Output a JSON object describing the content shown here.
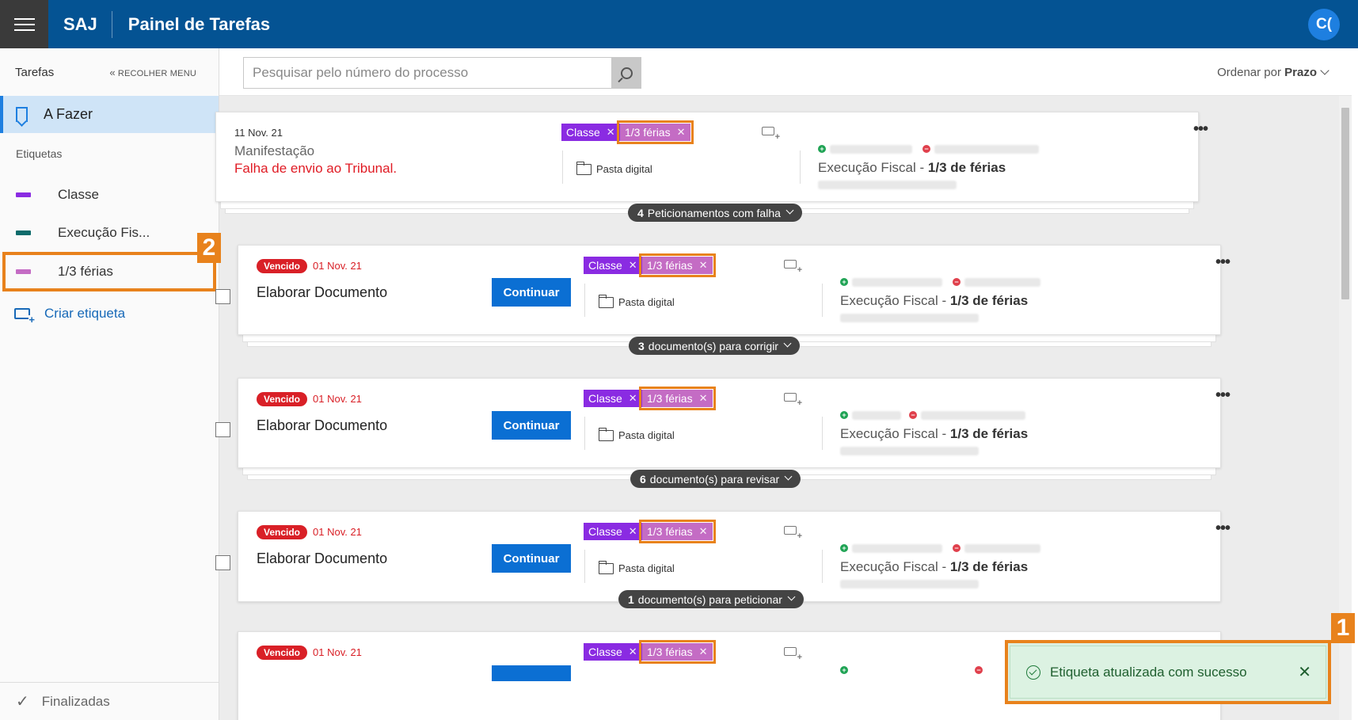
{
  "header": {
    "brand": "SAJ",
    "title": "Painel de Tarefas",
    "avatar": "C("
  },
  "sidebar": {
    "title": "Tarefas",
    "collapse_label": "RECOLHER MENU",
    "active_item": "A Fazer",
    "section_label": "Etiquetas",
    "tags": [
      {
        "label": "Classe",
        "color": "#8a2be2"
      },
      {
        "label": "Execução Fis...",
        "color": "#0d6b6b"
      },
      {
        "label": "1/3 férias",
        "color": "#c46cc4"
      }
    ],
    "create_label": "Criar etiqueta",
    "bottom_label": "Finalizadas",
    "callout_2": "2"
  },
  "toolbar": {
    "search_placeholder": "Pesquisar pelo número do processo",
    "sort_prefix": "Ordenar por",
    "sort_value": "Prazo"
  },
  "cards": [
    {
      "date": "11 Nov. 21",
      "title": "Manifestação",
      "error": "Falha de envio ao Tribunal.",
      "tags": [
        "Classe",
        "1/3 férias"
      ],
      "pasta": "Pasta digital",
      "exec_prefix": "Execução Fiscal -",
      "exec_bold": "1/3 de férias",
      "pill_count": "4",
      "pill_text": "Peticionamentos com falha"
    },
    {
      "status": "Vencido",
      "date": "01 Nov. 21",
      "title": "Elaborar Documento",
      "action": "Continuar",
      "tags": [
        "Classe",
        "1/3 férias"
      ],
      "pasta": "Pasta digital",
      "exec_prefix": "Execução Fiscal -",
      "exec_bold": "1/3 de férias",
      "pill_count": "3",
      "pill_text": "documento(s) para corrigir"
    },
    {
      "status": "Vencido",
      "date": "01 Nov. 21",
      "title": "Elaborar Documento",
      "action": "Continuar",
      "tags": [
        "Classe",
        "1/3 férias"
      ],
      "pasta": "Pasta digital",
      "exec_prefix": "Execução Fiscal -",
      "exec_bold": "1/3 de férias",
      "pill_count": "6",
      "pill_text": "documento(s) para revisar"
    },
    {
      "status": "Vencido",
      "date": "01 Nov. 21",
      "title": "Elaborar Documento",
      "action": "Continuar",
      "tags": [
        "Classe",
        "1/3 férias"
      ],
      "pasta": "Pasta digital",
      "exec_prefix": "Execução Fiscal -",
      "exec_bold": "1/3 de férias",
      "pill_count": "1",
      "pill_text": "documento(s) para peticionar"
    },
    {
      "status": "Vencido",
      "date": "01 Nov. 21",
      "tags": [
        "Classe",
        "1/3 férias"
      ]
    }
  ],
  "toast": {
    "text": "Etiqueta atualizada com sucesso",
    "close": "✕",
    "callout_1": "1"
  },
  "colors": {
    "header": "#045393",
    "accent": "#1e7fe0",
    "callout": "#e8821c",
    "overdue": "#d92027"
  }
}
